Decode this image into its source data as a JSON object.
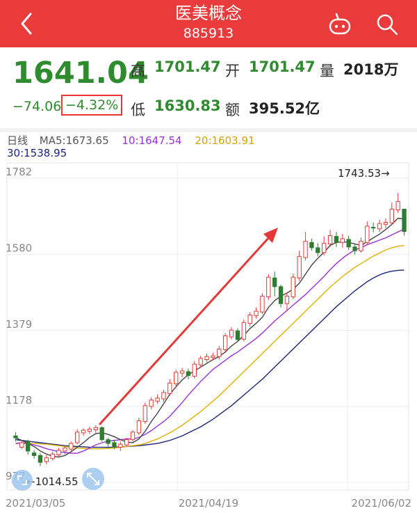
{
  "header": {
    "title": "医美概念",
    "code": "885913",
    "bg_color": "#e93b3b",
    "back_icon": "chevron-left-icon",
    "robot_icon": "robot-icon",
    "search_icon": "search-icon"
  },
  "quote": {
    "price": "1641.04",
    "change": "−74.06",
    "change_pct": "−4.32%",
    "high_label": "高",
    "high": "1701.47",
    "open_label": "开",
    "open": "1701.47",
    "volume_label": "量",
    "volume": "2018万",
    "low_label": "低",
    "low": "1630.83",
    "amount_label": "额",
    "amount": "395.52亿",
    "down_color": "#2e8b2e"
  },
  "ma_legend": {
    "k_label": "日线",
    "ma5": "MA5:1673.65",
    "ma10": "10:1647.54",
    "ma20": "20:1603.91",
    "ma30": "30:1538.95",
    "colors": {
      "ma5": "#444444",
      "ma10": "#9b30d9",
      "ma20": "#e0b000",
      "ma30": "#1a237e"
    }
  },
  "chart": {
    "max_label": "1743.53→",
    "min_label": "←1014.55",
    "zoom_icon": "expand-icon",
    "zoom_icon_left": "expand-icon"
  },
  "chart_data": {
    "type": "candlestick",
    "y_ticks": [
      "1782",
      "1580",
      "1379",
      "1178",
      "977"
    ],
    "x_ticks": [
      "2021/03/05",
      "2021/04/19",
      "2021/06/02"
    ],
    "ylim": [
      977,
      1782
    ],
    "candles": [
      [
        1100,
        1095,
        1110,
        1085
      ],
      [
        1070,
        1082,
        1090,
        1065
      ],
      [
        1085,
        1060,
        1090,
        1050
      ],
      [
        1055,
        1048,
        1062,
        1040
      ],
      [
        1048,
        1030,
        1055,
        1020
      ],
      [
        1032,
        1042,
        1050,
        1025
      ],
      [
        1040,
        1052,
        1058,
        1035
      ],
      [
        1050,
        1062,
        1068,
        1045
      ],
      [
        1060,
        1068,
        1075,
        1052
      ],
      [
        1065,
        1080,
        1085,
        1058
      ],
      [
        1082,
        1110,
        1118,
        1078
      ],
      [
        1108,
        1115,
        1120,
        1100
      ],
      [
        1112,
        1118,
        1125,
        1105
      ],
      [
        1116,
        1122,
        1128,
        1108
      ],
      [
        1122,
        1090,
        1125,
        1085
      ],
      [
        1090,
        1080,
        1095,
        1072
      ],
      [
        1082,
        1070,
        1090,
        1065
      ],
      [
        1070,
        1078,
        1085,
        1060
      ],
      [
        1076,
        1090,
        1095,
        1072
      ],
      [
        1090,
        1110,
        1115,
        1085
      ],
      [
        1108,
        1140,
        1148,
        1102
      ],
      [
        1138,
        1180,
        1188,
        1132
      ],
      [
        1178,
        1195,
        1202,
        1170
      ],
      [
        1192,
        1200,
        1210,
        1185
      ],
      [
        1198,
        1215,
        1222,
        1190
      ],
      [
        1212,
        1240,
        1250,
        1206
      ],
      [
        1238,
        1268,
        1275,
        1232
      ],
      [
        1266,
        1272,
        1280,
        1255
      ],
      [
        1270,
        1260,
        1278,
        1250
      ],
      [
        1258,
        1290,
        1298,
        1252
      ],
      [
        1288,
        1305,
        1312,
        1280
      ],
      [
        1302,
        1310,
        1318,
        1295
      ],
      [
        1308,
        1312,
        1320,
        1300
      ],
      [
        1310,
        1330,
        1338,
        1302
      ],
      [
        1328,
        1365,
        1372,
        1320
      ],
      [
        1362,
        1380,
        1388,
        1355
      ],
      [
        1378,
        1355,
        1385,
        1348
      ],
      [
        1356,
        1400,
        1408,
        1350
      ],
      [
        1398,
        1420,
        1428,
        1390
      ],
      [
        1418,
        1430,
        1440,
        1410
      ],
      [
        1428,
        1470,
        1478,
        1422
      ],
      [
        1468,
        1520,
        1528,
        1460
      ],
      [
        1518,
        1495,
        1535,
        1470
      ],
      [
        1495,
        1450,
        1500,
        1440
      ],
      [
        1450,
        1470,
        1480,
        1430
      ],
      [
        1468,
        1520,
        1530,
        1462
      ],
      [
        1518,
        1575,
        1590,
        1510
      ],
      [
        1572,
        1615,
        1640,
        1565
      ],
      [
        1612,
        1598,
        1622,
        1590
      ],
      [
        1598,
        1585,
        1610,
        1575
      ],
      [
        1585,
        1610,
        1628,
        1578
      ],
      [
        1608,
        1630,
        1645,
        1600
      ],
      [
        1628,
        1612,
        1640,
        1600
      ],
      [
        1612,
        1622,
        1635,
        1598
      ],
      [
        1620,
        1600,
        1630,
        1592
      ],
      [
        1600,
        1590,
        1608,
        1580
      ],
      [
        1590,
        1615,
        1625,
        1585
      ],
      [
        1612,
        1655,
        1668,
        1605
      ],
      [
        1652,
        1650,
        1665,
        1638
      ],
      [
        1648,
        1662,
        1672,
        1640
      ],
      [
        1660,
        1665,
        1675,
        1650
      ],
      [
        1664,
        1700,
        1718,
        1658
      ],
      [
        1698,
        1720,
        1743,
        1690
      ],
      [
        1700,
        1641,
        1701,
        1630
      ]
    ],
    "ma5": [
      1095,
      1088,
      1080,
      1072,
      1060,
      1052,
      1046,
      1044,
      1048,
      1058,
      1070,
      1082,
      1096,
      1106,
      1108,
      1104,
      1098,
      1090,
      1084,
      1082,
      1092,
      1112,
      1138,
      1160,
      1185,
      1210,
      1230,
      1248,
      1262,
      1272,
      1282,
      1292,
      1302,
      1310,
      1322,
      1338,
      1350,
      1366,
      1384,
      1398,
      1414,
      1440,
      1458,
      1470,
      1478,
      1488,
      1504,
      1528,
      1552,
      1570,
      1586,
      1604,
      1612,
      1614,
      1612,
      1608,
      1604,
      1614,
      1624,
      1634,
      1646,
      1660,
      1676,
      1674
    ],
    "ma10": [
      1080,
      1082,
      1080,
      1076,
      1072,
      1066,
      1062,
      1058,
      1056,
      1054,
      1054,
      1060,
      1068,
      1076,
      1082,
      1086,
      1088,
      1090,
      1092,
      1092,
      1096,
      1104,
      1114,
      1126,
      1138,
      1152,
      1170,
      1188,
      1208,
      1226,
      1244,
      1260,
      1276,
      1288,
      1300,
      1312,
      1322,
      1334,
      1346,
      1358,
      1372,
      1388,
      1404,
      1418,
      1432,
      1446,
      1460,
      1474,
      1490,
      1506,
      1522,
      1540,
      1556,
      1570,
      1582,
      1592,
      1598,
      1606,
      1612,
      1618,
      1624,
      1632,
      1640,
      1647
    ],
    "ma20": [
      1080,
      1080,
      1080,
      1080,
      1079,
      1078,
      1076,
      1074,
      1072,
      1070,
      1068,
      1067,
      1066,
      1066,
      1066,
      1067,
      1068,
      1070,
      1072,
      1074,
      1076,
      1080,
      1086,
      1092,
      1100,
      1108,
      1118,
      1128,
      1140,
      1152,
      1164,
      1178,
      1192,
      1206,
      1222,
      1238,
      1254,
      1270,
      1286,
      1302,
      1318,
      1334,
      1350,
      1366,
      1382,
      1398,
      1414,
      1430,
      1446,
      1462,
      1478,
      1494,
      1508,
      1522,
      1534,
      1546,
      1556,
      1566,
      1576,
      1584,
      1592,
      1598,
      1602,
      1604
    ],
    "ma30": [
      1090,
      1088,
      1086,
      1084,
      1082,
      1080,
      1078,
      1076,
      1074,
      1073,
      1072,
      1071,
      1070,
      1070,
      1070,
      1070,
      1070,
      1071,
      1072,
      1073,
      1074,
      1076,
      1078,
      1080,
      1084,
      1088,
      1094,
      1100,
      1108,
      1116,
      1124,
      1134,
      1144,
      1156,
      1168,
      1180,
      1194,
      1208,
      1222,
      1236,
      1250,
      1266,
      1282,
      1298,
      1314,
      1330,
      1346,
      1362,
      1378,
      1394,
      1410,
      1426,
      1442,
      1456,
      1470,
      1484,
      1496,
      1508,
      1518,
      1526,
      1532,
      1536,
      1538,
      1539
    ],
    "up_color": "#e53935",
    "down_color": "#2e7d32"
  }
}
